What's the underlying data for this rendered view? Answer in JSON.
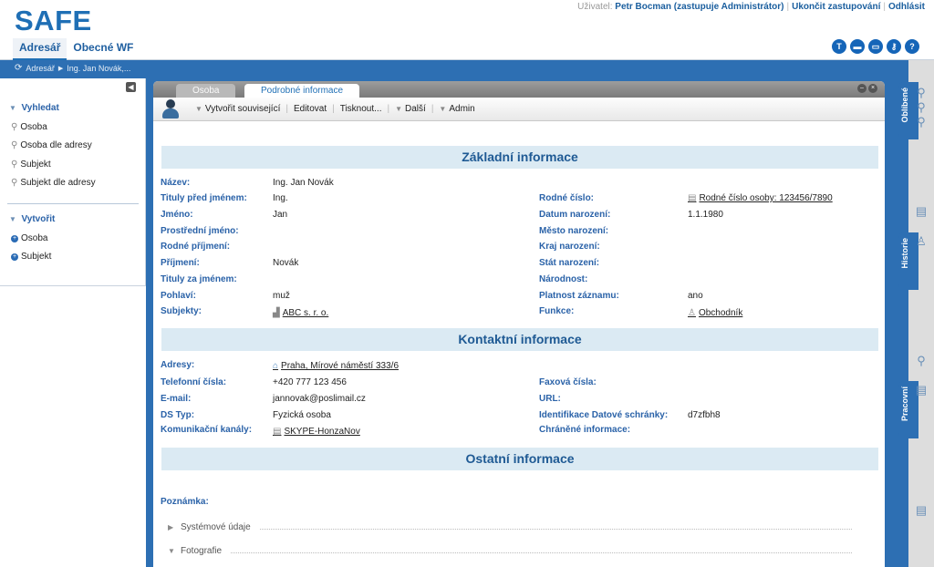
{
  "app": {
    "logo": "SAFE"
  },
  "userbar": {
    "label": "Uživatel:",
    "user": "Petr Bocman (zastupuje Administrátor)",
    "end_substitution": "Ukončit zastupování",
    "logout": "Odhlásit"
  },
  "main_tabs": [
    {
      "label": "Adresář"
    },
    {
      "label": "Obecné WF"
    }
  ],
  "top_icons": [
    {
      "name": "text-icon",
      "glyph": "T"
    },
    {
      "name": "window-icon",
      "glyph": "▬"
    },
    {
      "name": "screen-icon",
      "glyph": "▭"
    },
    {
      "name": "key-icon",
      "glyph": "⚷"
    },
    {
      "name": "help-icon",
      "glyph": "?"
    }
  ],
  "breadcrumb": {
    "items": [
      "Adresář",
      "Ing. Jan Novák,..."
    ]
  },
  "left_panel": {
    "search": {
      "title": "Vyhledat",
      "items": [
        "Osoba",
        "Osoba dle adresy",
        "Subjekt",
        "Subjekt dle adresy"
      ]
    },
    "create": {
      "title": "Vytvořit",
      "items": [
        "Osoba",
        "Subjekt"
      ]
    }
  },
  "panel": {
    "tabs": [
      {
        "label": "Osoba"
      },
      {
        "label": "Podrobné informace"
      }
    ],
    "toolbar": {
      "create_related": "Vytvořit související",
      "edit": "Editovat",
      "print": "Tisknout...",
      "more": "Další",
      "admin": "Admin"
    }
  },
  "sections": {
    "basic": "Základní informace",
    "contact": "Kontaktní informace",
    "other": "Ostatní informace"
  },
  "basic": {
    "left": [
      {
        "label": "Název:",
        "value": "Ing. Jan Novák"
      },
      {
        "label": "Tituly před jménem:",
        "value": "Ing."
      },
      {
        "label": "Jméno:",
        "value": "Jan"
      },
      {
        "label": "Prostřední jméno:",
        "value": ""
      },
      {
        "label": "Rodné příjmení:",
        "value": ""
      },
      {
        "label": "Příjmení:",
        "value": "Novák"
      },
      {
        "label": "Tituly za jménem:",
        "value": ""
      },
      {
        "label": "Pohlaví:",
        "value": "muž"
      },
      {
        "label": "Subjekty:",
        "value": "ABC s. r. o."
      }
    ],
    "right": [
      {
        "label": "Rodné číslo:",
        "value": "Rodné číslo osoby: 123456/7890"
      },
      {
        "label": "Datum narození:",
        "value": "1.1.1980"
      },
      {
        "label": "Město narození:",
        "value": ""
      },
      {
        "label": "Kraj narození:",
        "value": ""
      },
      {
        "label": "Stát narození:",
        "value": ""
      },
      {
        "label": "Národnost:",
        "value": ""
      },
      {
        "label": "Platnost záznamu:",
        "value": "ano"
      },
      {
        "label": "Funkce:",
        "value": "Obchodník"
      }
    ]
  },
  "contact": {
    "left": [
      {
        "label": "Adresy:",
        "value": "Praha, Mírové náměstí 333/6"
      },
      {
        "label": "Telefonní čísla:",
        "value": "+420 777 123 456"
      },
      {
        "label": "E-mail:",
        "value": "jannovak@poslimail.cz"
      },
      {
        "label": "DS Typ:",
        "value": "Fyzická osoba"
      },
      {
        "label": "Komunikační kanály:",
        "value": "SKYPE-HonzaNov"
      }
    ],
    "right": [
      {
        "label": "Faxová čísla:",
        "value": ""
      },
      {
        "label": "URL:",
        "value": ""
      },
      {
        "label": "Identifikace Datové schránky:",
        "value": "d7zfbh8"
      },
      {
        "label": "Chráněné informace:",
        "value": ""
      }
    ]
  },
  "other": {
    "note_label": "Poznámka:",
    "system_data": "Systémové údaje",
    "photos": "Fotografie"
  },
  "right_tabs": [
    {
      "label": "Oblíbené"
    },
    {
      "label": "Historie"
    },
    {
      "label": "Pracovní"
    }
  ]
}
